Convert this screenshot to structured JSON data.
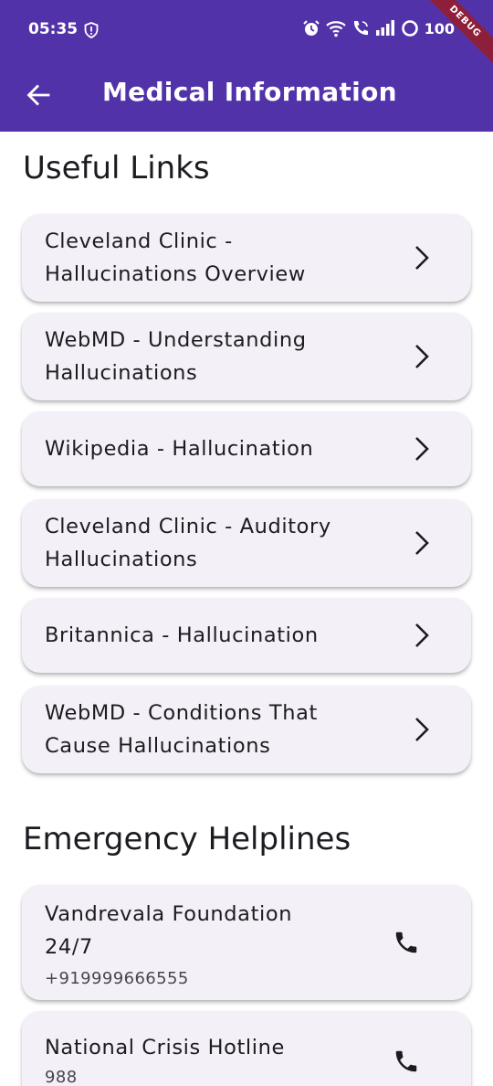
{
  "status_bar": {
    "time": "05:35",
    "battery": "100",
    "debug_label": "DEBUG"
  },
  "app_bar": {
    "title": "Medical Information",
    "back_icon": "arrow-back-icon",
    "background": "#5232a8"
  },
  "useful_links": {
    "title": "Useful Links",
    "items": [
      {
        "label": "Cleveland Clinic - Hallucinations Overview"
      },
      {
        "label": "WebMD - Understanding Hallucinations"
      },
      {
        "label": "Wikipedia - Hallucination"
      },
      {
        "label": "Cleveland Clinic - Auditory Hallucinations"
      },
      {
        "label": "Britannica - Hallucination"
      },
      {
        "label": "WebMD - Conditions That Cause Hallucinations"
      }
    ],
    "item_icon": "chevron-right-icon"
  },
  "helplines": {
    "title": "Emergency Helplines",
    "items": [
      {
        "name": "Vandrevala Foundation 24/7",
        "number": "+919999666555"
      },
      {
        "name": "National Crisis Hotline",
        "number": "988"
      }
    ],
    "item_icon": "phone-icon"
  },
  "colors": {
    "card_background": "#f4f0f8",
    "text": "#1d1b20"
  }
}
